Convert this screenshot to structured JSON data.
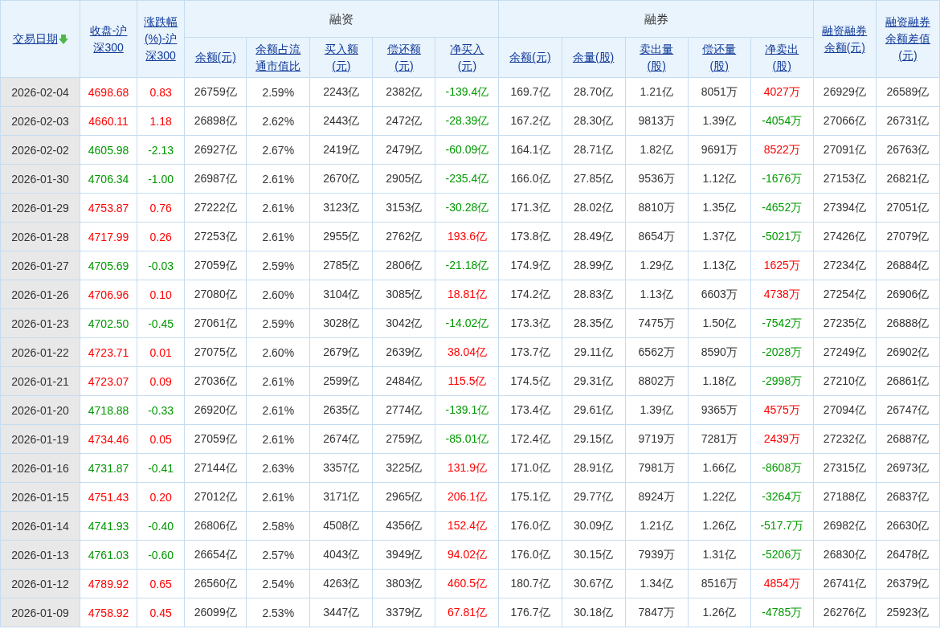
{
  "table": {
    "header": [
      {
        "lines": [
          "交易日期"
        ],
        "sorted": true
      },
      {
        "lines": [
          "收盘-沪",
          "深300"
        ]
      },
      {
        "lines": [
          "涨跌幅",
          "(%)-沪",
          "深300"
        ]
      },
      {
        "label": "融资",
        "columns": [
          {
            "lines": [
              "余额(元)"
            ]
          },
          {
            "lines": [
              "余额占流",
              "通市值比"
            ]
          },
          {
            "lines": [
              "买入额",
              "(元)"
            ]
          },
          {
            "lines": [
              "偿还额",
              "(元)"
            ]
          },
          {
            "lines": [
              "净买入",
              "(元)"
            ]
          }
        ]
      },
      {
        "label": "融券",
        "columns": [
          {
            "lines": [
              "余额(元)"
            ]
          },
          {
            "lines": [
              "余量(股)"
            ]
          },
          {
            "lines": [
              "卖出量",
              "(股)"
            ]
          },
          {
            "lines": [
              "偿还量",
              "(股)"
            ]
          },
          {
            "lines": [
              "净卖出",
              "(股)"
            ]
          }
        ]
      },
      {
        "lines": [
          "融资融券",
          "余额(元)"
        ]
      },
      {
        "lines": [
          "融资融券",
          "余额差值",
          "(元)"
        ]
      }
    ],
    "rows": [
      {
        "cells": [
          "2026-02-04",
          {
            "text": "4698.68",
            "color": "#ff0000"
          },
          {
            "text": "0.83",
            "color": "#ff0000"
          },
          "26759亿",
          "2.59%",
          "2243亿",
          "2382亿",
          {
            "text": "-139.4亿",
            "color": "#009900"
          },
          "169.7亿",
          "28.70亿",
          "1.21亿",
          "8051万",
          {
            "text": "4027万",
            "color": "#ff0000"
          },
          "26929亿",
          "26589亿"
        ]
      },
      {
        "cells": [
          "2026-02-03",
          {
            "text": "4660.11",
            "color": "#ff0000"
          },
          {
            "text": "1.18",
            "color": "#ff0000"
          },
          "26898亿",
          "2.62%",
          "2443亿",
          "2472亿",
          {
            "text": "-28.39亿",
            "color": "#009900"
          },
          "167.2亿",
          "28.30亿",
          "9813万",
          "1.39亿",
          {
            "text": "-4054万",
            "color": "#009900"
          },
          "27066亿",
          "26731亿"
        ]
      },
      {
        "cells": [
          "2026-02-02",
          {
            "text": "4605.98",
            "color": "#009900"
          },
          {
            "text": "-2.13",
            "color": "#009900"
          },
          "26927亿",
          "2.67%",
          "2419亿",
          "2479亿",
          {
            "text": "-60.09亿",
            "color": "#009900"
          },
          "164.1亿",
          "28.71亿",
          "1.82亿",
          "9691万",
          {
            "text": "8522万",
            "color": "#ff0000"
          },
          "27091亿",
          "26763亿"
        ]
      },
      {
        "cells": [
          "2026-01-30",
          {
            "text": "4706.34",
            "color": "#009900"
          },
          {
            "text": "-1.00",
            "color": "#009900"
          },
          "26987亿",
          "2.61%",
          "2670亿",
          "2905亿",
          {
            "text": "-235.4亿",
            "color": "#009900"
          },
          "166.0亿",
          "27.85亿",
          "9536万",
          "1.12亿",
          {
            "text": "-1676万",
            "color": "#009900"
          },
          "27153亿",
          "26821亿"
        ]
      },
      {
        "cells": [
          "2026-01-29",
          {
            "text": "4753.87",
            "color": "#ff0000"
          },
          {
            "text": "0.76",
            "color": "#ff0000"
          },
          "27222亿",
          "2.61%",
          "3123亿",
          "3153亿",
          {
            "text": "-30.28亿",
            "color": "#009900"
          },
          "171.3亿",
          "28.02亿",
          "8810万",
          "1.35亿",
          {
            "text": "-4652万",
            "color": "#009900"
          },
          "27394亿",
          "27051亿"
        ]
      },
      {
        "cells": [
          "2026-01-28",
          {
            "text": "4717.99",
            "color": "#ff0000"
          },
          {
            "text": "0.26",
            "color": "#ff0000"
          },
          "27253亿",
          "2.61%",
          "2955亿",
          "2762亿",
          {
            "text": "193.6亿",
            "color": "#ff0000"
          },
          "173.8亿",
          "28.49亿",
          "8654万",
          "1.37亿",
          {
            "text": "-5021万",
            "color": "#009900"
          },
          "27426亿",
          "27079亿"
        ]
      },
      {
        "cells": [
          "2026-01-27",
          {
            "text": "4705.69",
            "color": "#009900"
          },
          {
            "text": "-0.03",
            "color": "#009900"
          },
          "27059亿",
          "2.59%",
          "2785亿",
          "2806亿",
          {
            "text": "-21.18亿",
            "color": "#009900"
          },
          "174.9亿",
          "28.99亿",
          "1.29亿",
          "1.13亿",
          {
            "text": "1625万",
            "color": "#ff0000"
          },
          "27234亿",
          "26884亿"
        ]
      },
      {
        "cells": [
          "2026-01-26",
          {
            "text": "4706.96",
            "color": "#ff0000"
          },
          {
            "text": "0.10",
            "color": "#ff0000"
          },
          "27080亿",
          "2.60%",
          "3104亿",
          "3085亿",
          {
            "text": "18.81亿",
            "color": "#ff0000"
          },
          "174.2亿",
          "28.83亿",
          "1.13亿",
          "6603万",
          {
            "text": "4738万",
            "color": "#ff0000"
          },
          "27254亿",
          "26906亿"
        ]
      },
      {
        "cells": [
          "2026-01-23",
          {
            "text": "4702.50",
            "color": "#009900"
          },
          {
            "text": "-0.45",
            "color": "#009900"
          },
          "27061亿",
          "2.59%",
          "3028亿",
          "3042亿",
          {
            "text": "-14.02亿",
            "color": "#009900"
          },
          "173.3亿",
          "28.35亿",
          "7475万",
          "1.50亿",
          {
            "text": "-7542万",
            "color": "#009900"
          },
          "27235亿",
          "26888亿"
        ]
      },
      {
        "cells": [
          "2026-01-22",
          {
            "text": "4723.71",
            "color": "#ff0000"
          },
          {
            "text": "0.01",
            "color": "#ff0000"
          },
          "27075亿",
          "2.60%",
          "2679亿",
          "2639亿",
          {
            "text": "38.04亿",
            "color": "#ff0000"
          },
          "173.7亿",
          "29.11亿",
          "6562万",
          "8590万",
          {
            "text": "-2028万",
            "color": "#009900"
          },
          "27249亿",
          "26902亿"
        ]
      },
      {
        "cells": [
          "2026-01-21",
          {
            "text": "4723.07",
            "color": "#ff0000"
          },
          {
            "text": "0.09",
            "color": "#ff0000"
          },
          "27036亿",
          "2.61%",
          "2599亿",
          "2484亿",
          {
            "text": "115.5亿",
            "color": "#ff0000"
          },
          "174.5亿",
          "29.31亿",
          "8802万",
          "1.18亿",
          {
            "text": "-2998万",
            "color": "#009900"
          },
          "27210亿",
          "26861亿"
        ]
      },
      {
        "cells": [
          "2026-01-20",
          {
            "text": "4718.88",
            "color": "#009900"
          },
          {
            "text": "-0.33",
            "color": "#009900"
          },
          "26920亿",
          "2.61%",
          "2635亿",
          "2774亿",
          {
            "text": "-139.1亿",
            "color": "#009900"
          },
          "173.4亿",
          "29.61亿",
          "1.39亿",
          "9365万",
          {
            "text": "4575万",
            "color": "#ff0000"
          },
          "27094亿",
          "26747亿"
        ]
      },
      {
        "cells": [
          "2026-01-19",
          {
            "text": "4734.46",
            "color": "#ff0000"
          },
          {
            "text": "0.05",
            "color": "#ff0000"
          },
          "27059亿",
          "2.61%",
          "2674亿",
          "2759亿",
          {
            "text": "-85.01亿",
            "color": "#009900"
          },
          "172.4亿",
          "29.15亿",
          "9719万",
          "7281万",
          {
            "text": "2439万",
            "color": "#ff0000"
          },
          "27232亿",
          "26887亿"
        ]
      },
      {
        "cells": [
          "2026-01-16",
          {
            "text": "4731.87",
            "color": "#009900"
          },
          {
            "text": "-0.41",
            "color": "#009900"
          },
          "27144亿",
          "2.63%",
          "3357亿",
          "3225亿",
          {
            "text": "131.9亿",
            "color": "#ff0000"
          },
          "171.0亿",
          "28.91亿",
          "7981万",
          "1.66亿",
          {
            "text": "-8608万",
            "color": "#009900"
          },
          "27315亿",
          "26973亿"
        ]
      },
      {
        "cells": [
          "2026-01-15",
          {
            "text": "4751.43",
            "color": "#ff0000"
          },
          {
            "text": "0.20",
            "color": "#ff0000"
          },
          "27012亿",
          "2.61%",
          "3171亿",
          "2965亿",
          {
            "text": "206.1亿",
            "color": "#ff0000"
          },
          "175.1亿",
          "29.77亿",
          "8924万",
          "1.22亿",
          {
            "text": "-3264万",
            "color": "#009900"
          },
          "27188亿",
          "26837亿"
        ]
      },
      {
        "cells": [
          "2026-01-14",
          {
            "text": "4741.93",
            "color": "#009900"
          },
          {
            "text": "-0.40",
            "color": "#009900"
          },
          "26806亿",
          "2.58%",
          "4508亿",
          "4356亿",
          {
            "text": "152.4亿",
            "color": "#ff0000"
          },
          "176.0亿",
          "30.09亿",
          "1.21亿",
          "1.26亿",
          {
            "text": "-517.7万",
            "color": "#009900"
          },
          "26982亿",
          "26630亿"
        ]
      },
      {
        "cells": [
          "2026-01-13",
          {
            "text": "4761.03",
            "color": "#009900"
          },
          {
            "text": "-0.60",
            "color": "#009900"
          },
          "26654亿",
          "2.57%",
          "4043亿",
          "3949亿",
          {
            "text": "94.02亿",
            "color": "#ff0000"
          },
          "176.0亿",
          "30.15亿",
          "7939万",
          "1.31亿",
          {
            "text": "-5206万",
            "color": "#009900"
          },
          "26830亿",
          "26478亿"
        ]
      },
      {
        "cells": [
          "2026-01-12",
          {
            "text": "4789.92",
            "color": "#ff0000"
          },
          {
            "text": "0.65",
            "color": "#ff0000"
          },
          "26560亿",
          "2.54%",
          "4263亿",
          "3803亿",
          {
            "text": "460.5亿",
            "color": "#ff0000"
          },
          "180.7亿",
          "30.67亿",
          "1.34亿",
          "8516万",
          {
            "text": "4854万",
            "color": "#ff0000"
          },
          "26741亿",
          "26379亿"
        ]
      },
      {
        "cells": [
          "2026-01-09",
          {
            "text": "4758.92",
            "color": "#ff0000"
          },
          {
            "text": "0.45",
            "color": "#ff0000"
          },
          "26099亿",
          "2.53%",
          "3447亿",
          "3379亿",
          {
            "text": "67.81亿",
            "color": "#ff0000"
          },
          "176.7亿",
          "30.18亿",
          "7847万",
          "1.26亿",
          {
            "text": "-4785万",
            "color": "#009900"
          },
          "26276亿",
          "25923亿"
        ]
      }
    ]
  }
}
